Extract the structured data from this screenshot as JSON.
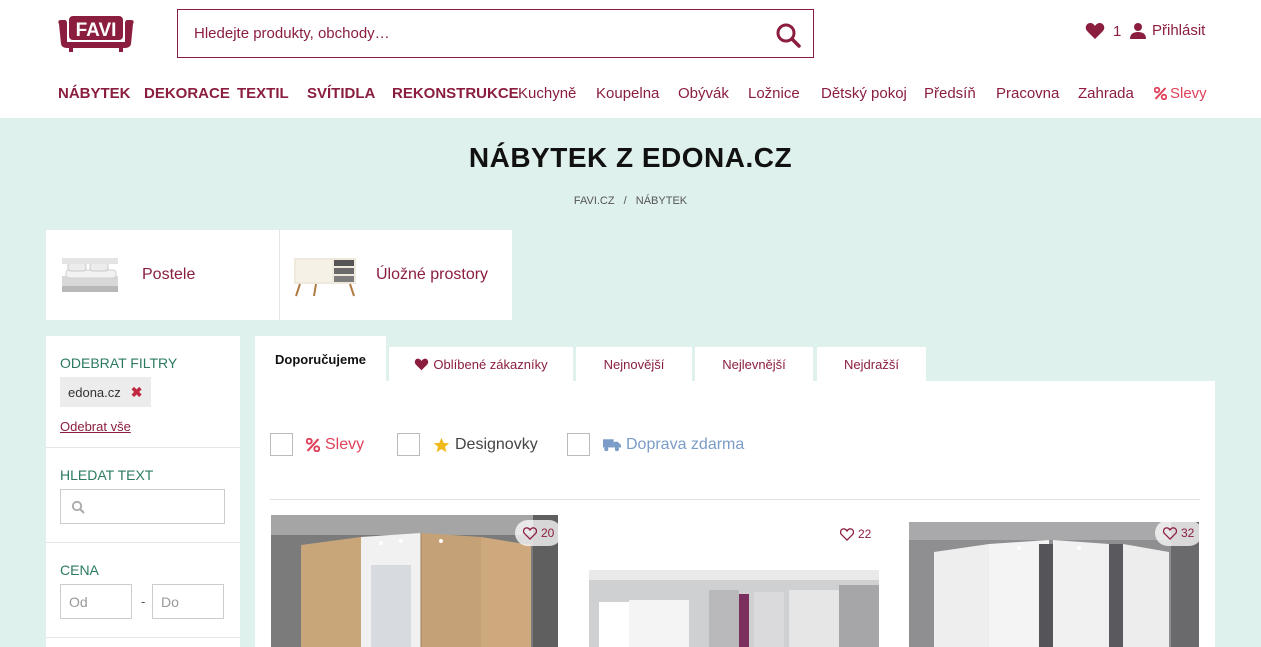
{
  "header": {
    "logo_text": "FAVI",
    "search_placeholder": "Hledejte produkty, obchody…",
    "favorites_count": "1",
    "login_label": "Přihlásit"
  },
  "nav": {
    "items": [
      {
        "label": "NÁBYTEK"
      },
      {
        "label": "DEKORACE"
      },
      {
        "label": "TEXTIL"
      },
      {
        "label": "SVÍTIDLA"
      },
      {
        "label": "REKONSTRUKCE"
      },
      {
        "label": "Kuchyně"
      },
      {
        "label": "Koupelna"
      },
      {
        "label": "Obývák"
      },
      {
        "label": "Ložnice"
      },
      {
        "label": "Dětský pokoj"
      },
      {
        "label": "Předsíň"
      },
      {
        "label": "Pracovna"
      },
      {
        "label": "Zahrada"
      },
      {
        "label": "Slevy"
      }
    ]
  },
  "page": {
    "title": "NÁBYTEK Z EDONA.CZ",
    "breadcrumb": [
      "FAVI.CZ",
      "/",
      "NÁBYTEK"
    ]
  },
  "categories": [
    {
      "label": "Postele"
    },
    {
      "label": "Úložné prostory"
    }
  ],
  "sidebar": {
    "remove_filters_title": "ODEBRAT FILTRY",
    "active_filter": "edona.cz",
    "remove_all": "Odebrat vše",
    "search_title": "HLEDAT TEXT",
    "price_title": "CENA",
    "price_from_placeholder": "Od",
    "price_dash": "-",
    "price_to_placeholder": "Do"
  },
  "sort_tabs": [
    {
      "label": "Doporučujeme",
      "active": true
    },
    {
      "label": "Oblíbené zákazníky",
      "active": false
    },
    {
      "label": "Nejnovější",
      "active": false
    },
    {
      "label": "Nejlevnější",
      "active": false
    },
    {
      "label": "Nejdražší",
      "active": false
    }
  ],
  "quick_filters": [
    {
      "label": "Slevy",
      "icon": "percent-icon",
      "color": "#e0415b"
    },
    {
      "label": "Designovky",
      "icon": "star-icon",
      "color": "#444444"
    },
    {
      "label": "Doprava zdarma",
      "icon": "truck-icon",
      "color": "#7a9cc6"
    }
  ],
  "products": [
    {
      "likes": "20"
    },
    {
      "likes": "22"
    },
    {
      "likes": "32"
    }
  ],
  "colors": {
    "brand": "#8b1e3f",
    "mint_background": "#dff1ec",
    "sale": "#e0415b",
    "filter_heading": "#2b7a5f"
  }
}
